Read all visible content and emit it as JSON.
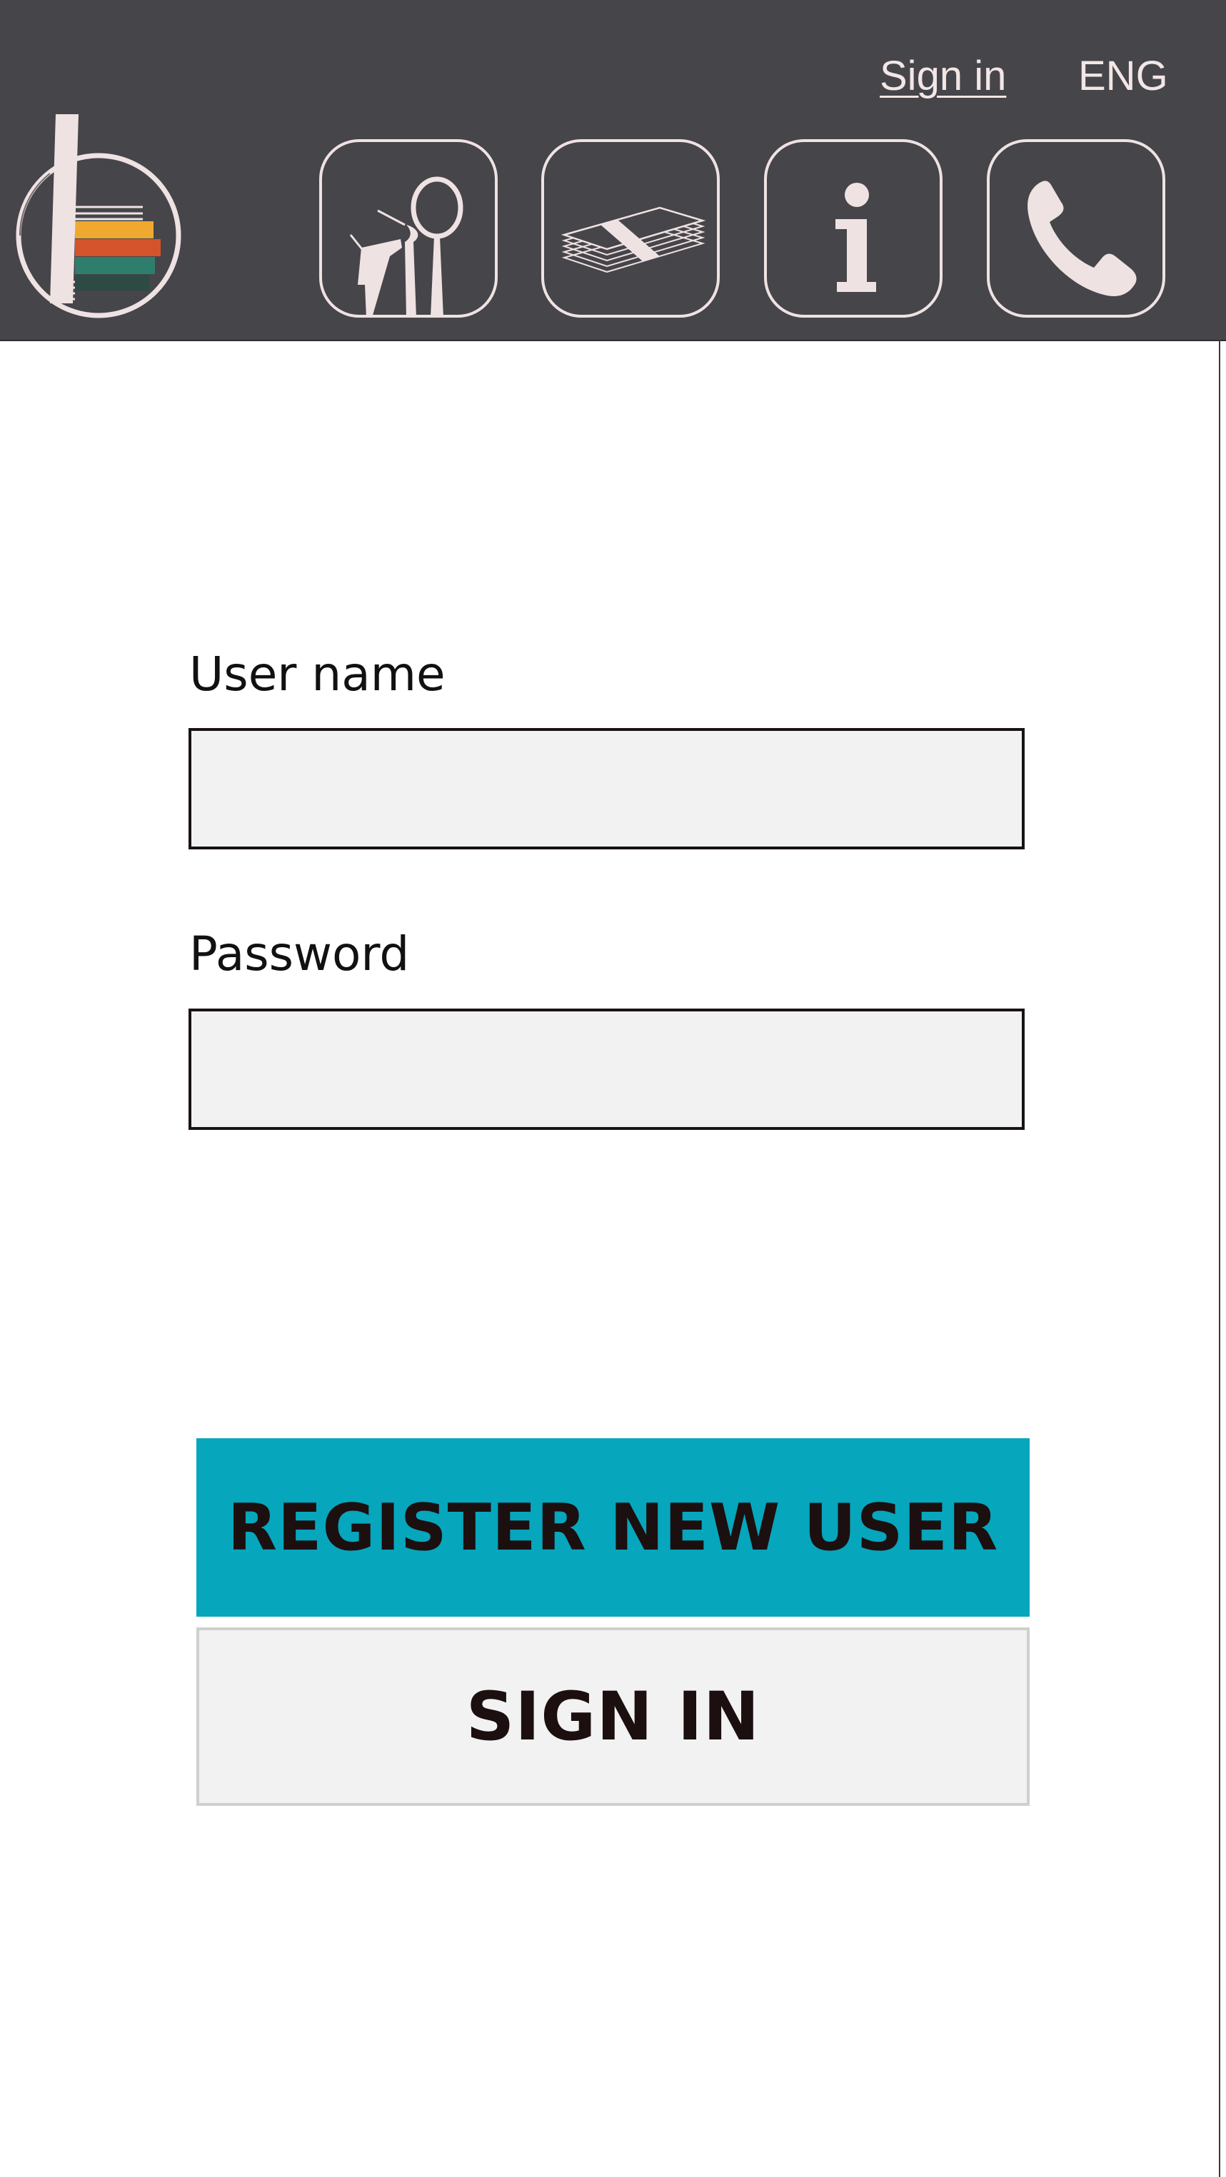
{
  "header": {
    "signin_link": "Sign in",
    "language": "ENG",
    "nav": [
      {
        "icon": "dental-tools-icon"
      },
      {
        "icon": "money-stack-icon"
      },
      {
        "icon": "info-icon"
      },
      {
        "icon": "phone-icon"
      }
    ]
  },
  "form": {
    "username_label": "User name",
    "username_value": "",
    "password_label": "Password",
    "password_value": "",
    "register_button": "REGISTER NEW USER",
    "signin_button": "SIGN IN"
  },
  "colors": {
    "header_bg": "#464549",
    "icon_stroke": "#efe2e2",
    "register_bg": "#06a6bd",
    "input_bg": "#f2f2f2",
    "logo_yellow": "#f0a92f",
    "logo_orange": "#d5532a",
    "logo_teal": "#2e7e6e",
    "logo_dark_teal": "#2d4a44"
  }
}
